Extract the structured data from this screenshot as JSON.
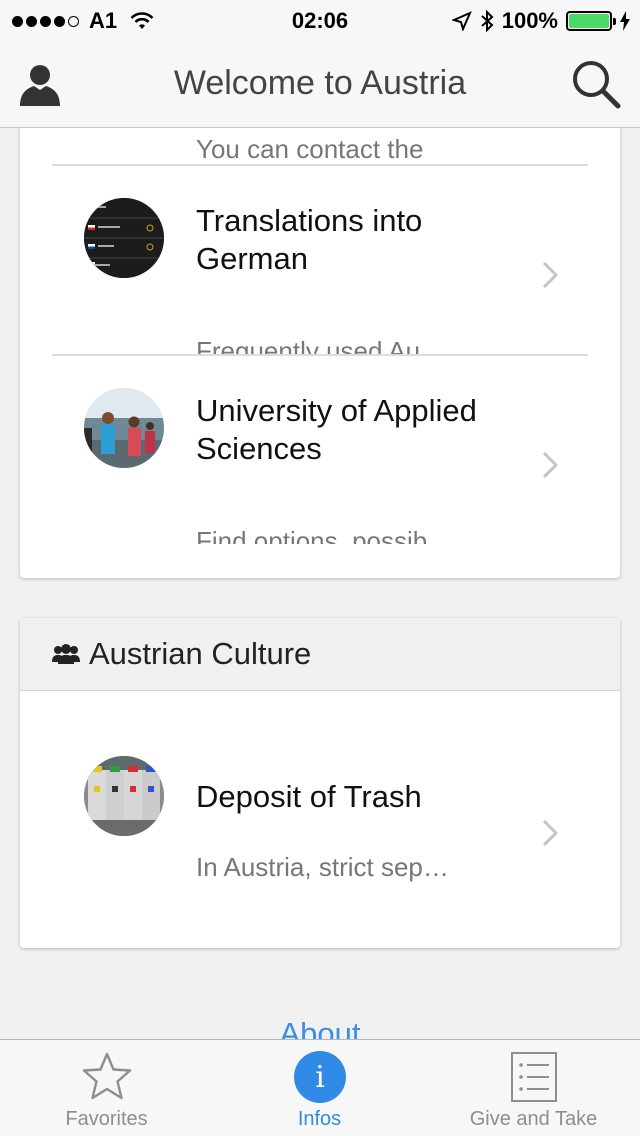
{
  "status_bar": {
    "carrier": "A1",
    "time": "02:06",
    "battery_percent": "100%",
    "battery_level": 1.0,
    "battery_color": "#4cd964"
  },
  "nav": {
    "title": "Welcome to Austria",
    "left_icon": "user-icon",
    "right_icon": "search-icon"
  },
  "section_top": {
    "items": [
      {
        "subtitle": "You can contact the"
      },
      {
        "title": "Translations into German",
        "subtitle": "Frequently used Au",
        "icon": "flags-list-thumbnail"
      },
      {
        "title": "University of Applied Sciences",
        "subtitle": "Find options, possib",
        "icon": "students-photo-thumbnail"
      }
    ]
  },
  "section_culture": {
    "header": "Austrian Culture",
    "header_icon": "group-icon",
    "items": [
      {
        "title": "Deposit of Trash",
        "subtitle": "In Austria, strict sep…",
        "icon": "trash-bins-thumbnail"
      }
    ]
  },
  "about_link": "About",
  "tab_bar": {
    "tabs": [
      {
        "label": "Favorites",
        "icon": "star-icon",
        "active": false
      },
      {
        "label": "Infos",
        "icon": "info-icon",
        "active": true
      },
      {
        "label": "Give and Take",
        "icon": "list-icon",
        "active": false
      }
    ],
    "active_color": "#2f8be6",
    "inactive_color": "#8e8e8e"
  }
}
